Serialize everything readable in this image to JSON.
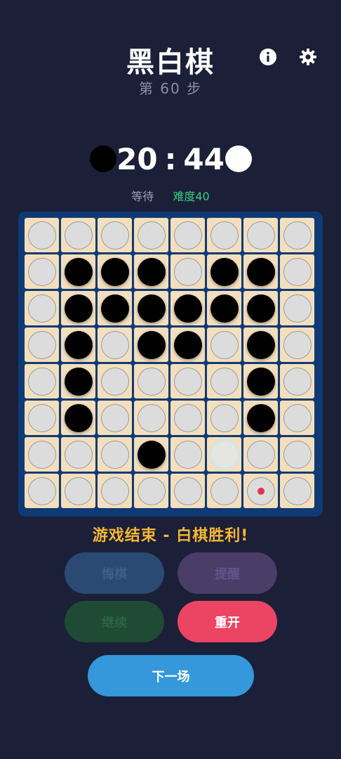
{
  "header": {
    "title": "黑白棋",
    "step": "第 60 步",
    "info_icon": "info-icon",
    "settings_icon": "gear-icon"
  },
  "score": {
    "black": "20",
    "separator": ":",
    "white": "44"
  },
  "status": {
    "turn_text": "等待",
    "difficulty": "难度40"
  },
  "board": {
    "size": 8,
    "legend": {
      "E": "empty",
      "B": "black",
      "G": "ghost",
      "D": "hint-dot"
    },
    "rows": [
      "EEEEEEEE",
      "EBBBEBBE",
      "EBBBBBBE",
      "EBEBBEBE",
      "EBEEEEBE",
      "EBEEEEBE",
      "EEEBEGEE",
      "EEEEEEDE"
    ],
    "colors": {
      "board_border": "#0f3a73",
      "cell": "#f3dfbd",
      "hint_dot": "#e0344e"
    }
  },
  "result_text": "游戏结束 - 白棋胜利!",
  "buttons": {
    "undo": "悔棋",
    "hint": "提醒",
    "continue": "继续",
    "restart": "重开",
    "next": "下一场"
  }
}
